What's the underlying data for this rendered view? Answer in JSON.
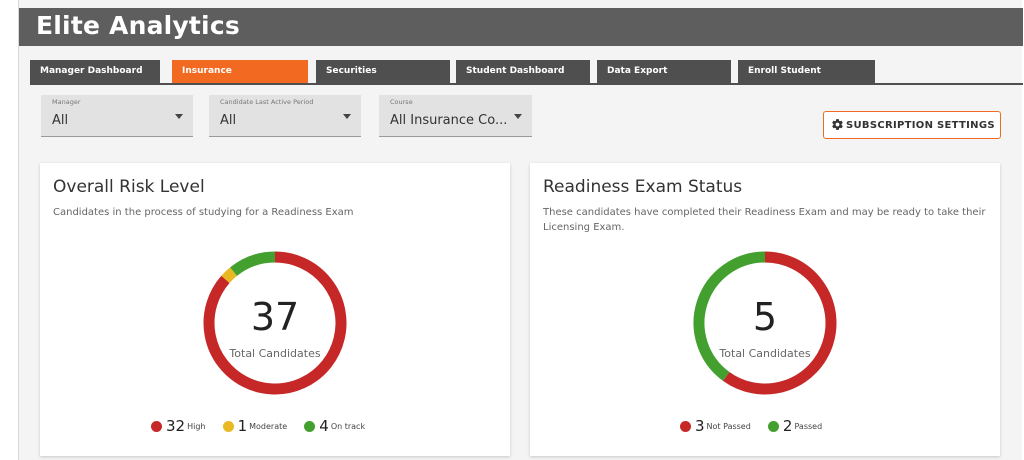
{
  "app": {
    "title": "Elite Analytics"
  },
  "tabs": [
    {
      "label": "Manager Dashboard",
      "active": false
    },
    {
      "label": "Insurance",
      "active": true
    },
    {
      "label": "Securities",
      "active": false
    },
    {
      "label": "Student Dashboard",
      "active": false
    },
    {
      "label": "Data Export",
      "active": false
    },
    {
      "label": "Enroll Student",
      "active": false
    }
  ],
  "filters": {
    "manager": {
      "label": "Manager",
      "value": "All"
    },
    "period": {
      "label": "Candidate Last Active Period",
      "value": "All"
    },
    "course": {
      "label": "Course",
      "value": "All Insurance Co..."
    }
  },
  "subscription_button": {
    "label": "SUBSCRIPTION SETTINGS",
    "icon": "gear-icon"
  },
  "colors": {
    "high": "#c62828",
    "moderate": "#e8b923",
    "on_track": "#43a02f",
    "accent": "#f26a21"
  },
  "risk_card": {
    "title": "Overall Risk Level",
    "subtitle": "Candidates in the process of studying for a Readiness Exam",
    "total": "37",
    "total_label": "Total Candidates",
    "segments": [
      {
        "label": "High",
        "value": 32,
        "color": "#c62828"
      },
      {
        "label": "Moderate",
        "value": 1,
        "color": "#e8b923"
      },
      {
        "label": "On track",
        "value": 4,
        "color": "#43a02f"
      }
    ]
  },
  "readiness_card": {
    "title": "Readiness Exam Status",
    "subtitle": "These candidates have completed their Readiness Exam and may be ready to take their Licensing Exam.",
    "total": "5",
    "total_label": "Total Candidates",
    "segments": [
      {
        "label": "Not Passed",
        "value": 3,
        "color": "#c62828"
      },
      {
        "label": "Passed",
        "value": 2,
        "color": "#43a02f"
      }
    ]
  }
}
